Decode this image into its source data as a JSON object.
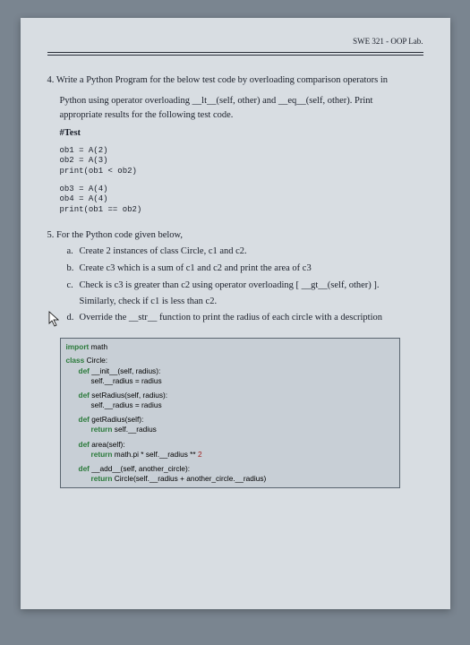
{
  "header": "SWE 321 - OOP Lab.",
  "q4": {
    "num": "4.",
    "line1": "Write a Python Program for the below test code by overloading comparison operators in",
    "line2_a": "Python using operator overloading ",
    "line2_lt": "__lt__(self, other)",
    "line2_and": " and ",
    "line2_eq": "__eq__(self, other)",
    "line2_end": ". Print",
    "line3": "appropriate results for the following test code.",
    "test_header": "#Test",
    "test_code1": "ob1 = A(2)\nob2 = A(3)\nprint(ob1 < ob2)",
    "test_code2": "ob3 = A(4)\nob4 = A(4)\nprint(ob1 == ob2)"
  },
  "q5": {
    "num": "5.",
    "intro": "For the Python code given below,",
    "a": "Create 2 instances of class Circle, c1 and c2.",
    "b": "Create c3 which is a sum of c1 and c2 and print the area of c3",
    "c1": "Check is c3 is greater than c2 using operator overloading [ ",
    "c_gt": "__gt__(self, other)",
    "c2": " ].",
    "c_indent": "Similarly, check if c1 is less than c2.",
    "d": "Override the __str__ function to print the radius of each circle with a description"
  },
  "code": {
    "l1": "import",
    "l1b": " math",
    "l2a": "class",
    "l2b": " Circle:",
    "l3a": "def",
    "l3b": " __init__(self, radius):",
    "l4": "self.__radius = radius",
    "l5a": "def",
    "l5b": " setRadius(self, radius):",
    "l6": "self.__radius = radius",
    "l7a": "def",
    "l7b": " getRadius(self):",
    "l8a": "return",
    "l8b": " self.__radius",
    "l9a": "def",
    "l9b": " area(self):",
    "l10a": "return",
    "l10b": " math.pi * self.__radius ** ",
    "l10c": "2",
    "l11a": "def",
    "l11b": " __add__(self, another_circle):",
    "l12a": "return",
    "l12b": " Circle(self.__radius + another_circle.__radius)"
  }
}
